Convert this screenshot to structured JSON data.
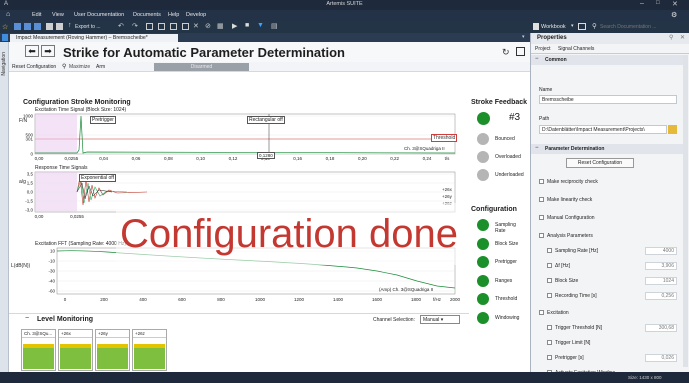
{
  "window": {
    "title": "Artemis SUITE",
    "size_status": "Size: 1430 x 800"
  },
  "menu": {
    "items": [
      "Edit",
      "View",
      "User Documentation",
      "Documents",
      "Help",
      "Develop"
    ]
  },
  "toolbar": {
    "export_label": "Export to ...",
    "workbook_label": "Workbook",
    "search_placeholder": "Search Documentation ..."
  },
  "doc_tab": {
    "label": "Impact Measurement (Roving Hammer) – Bremsscheibe*"
  },
  "leftstrip": {
    "label": "Navigation"
  },
  "page": {
    "title": "Strike for Automatic Parameter Determination",
    "reset_config": "Reset Configuration",
    "maximize": "Maximize",
    "arm": "Arm",
    "disarmed": "Disarmed"
  },
  "monitoring": {
    "title": "Configuration Stroke Monitoring",
    "chart1": {
      "title": "Excitation Time Signal (Block Size: 1024)",
      "ylabel": "F/N",
      "pretrigger": "Pretrigger",
      "rect": "Rectangular off",
      "threshold": "Threshold",
      "legend": "Ch. 3@SQuadriga II",
      "cursor": "0,1280"
    },
    "chart2": {
      "title": "Response Time Signals",
      "ylabel": "a/g",
      "exp": "Exponential off",
      "legend": [
        "+26x",
        "+26y",
        "+26z"
      ]
    },
    "chart3": {
      "title": "Excitation FFT (Sampling Rate: 4000 Hz)",
      "ylabel": "L(dB(N))",
      "legend": "(Amp) Ch. 3@SQuadriga II",
      "xunit": "f/Hz"
    }
  },
  "chart_data": [
    {
      "type": "line",
      "title": "Excitation Time Signal (Block Size: 1024)",
      "ylabel": "F/N",
      "xlabel": "t/s",
      "x_ticks": [
        "0,00",
        "0,0255",
        "0,04",
        "0,06",
        "0,08",
        "0,10",
        "0,12",
        "0,14",
        "0,16",
        "0,18",
        "0,20",
        "0,22",
        "0,24"
      ],
      "y_ticks": [
        "0",
        "301",
        "500",
        "1000"
      ],
      "xlim": [
        0,
        0.25
      ],
      "ylim": [
        0,
        1000
      ]
    },
    {
      "type": "line",
      "title": "Response Time Signals",
      "ylabel": "a/g",
      "x_ticks": [
        "0,00",
        "0,0255"
      ],
      "y_ticks": [
        "3,5",
        "1,5",
        "0,0",
        "-1,5",
        "-3,0"
      ],
      "ylim": [
        -3,
        3.5
      ]
    },
    {
      "type": "line",
      "title": "Excitation FFT (Sampling Rate: 4000 Hz)",
      "ylabel": "L(dB(N))",
      "xlabel": "f/Hz",
      "x_ticks": [
        "0",
        "200",
        "400",
        "600",
        "800",
        "1000",
        "1200",
        "1400",
        "1600",
        "1800",
        "2000"
      ],
      "y_ticks": [
        "10",
        "-10",
        "-30",
        "-40",
        "-60"
      ],
      "xlim": [
        0,
        2000
      ],
      "ylim": [
        -60,
        10
      ]
    }
  ],
  "overlay_text": "Configuration done",
  "feedback": {
    "title": "Stroke Feedback",
    "count": "#3",
    "items": [
      {
        "label": "Bounced",
        "state": "grey"
      },
      {
        "label": "Overloaded",
        "state": "grey"
      },
      {
        "label": "Underloaded",
        "state": "grey"
      }
    ]
  },
  "configuration": {
    "title": "Configuration",
    "items": [
      "Sampling Rate",
      "Block Size",
      "Pretrigger",
      "Ranges",
      "Threshold",
      "Windowing"
    ]
  },
  "level": {
    "title": "Level Monitoring",
    "channel_label": "Channel Selection:",
    "channel_value": "Manual",
    "meters": [
      "Ch. 3@SQu...",
      "+26x",
      "+26y",
      "+26z"
    ]
  },
  "properties": {
    "title": "Properties",
    "tabs": [
      "Project",
      "Signal Channels"
    ],
    "common": "Common",
    "name_label": "Name",
    "name_value": "Bremsscheibe",
    "path_label": "Path",
    "path_value": "D:\\Datenblätter\\Impact Measurement\\Projects\\",
    "param_section": "Parameter Determination",
    "reset_btn": "Reset Configuration",
    "checks": [
      "Make reciprocity check",
      "Make linearity check",
      "Manual Configuration"
    ],
    "analysis": "Analysis Parameters",
    "analysis_rows": [
      {
        "label": "Sampling Rate [Hz]",
        "value": "4000"
      },
      {
        "label": "Δf [Hz]",
        "value": "3,906"
      },
      {
        "label": "Block Size",
        "value": "1024"
      },
      {
        "label": "Recording Time [s]",
        "value": "0,256"
      }
    ],
    "excitation": "Excitation",
    "excitation_rows": [
      {
        "label": "Trigger Threshold [N]",
        "value": "300,68"
      },
      {
        "label": "Trigger Limit [N]",
        "value": ""
      },
      {
        "label": "Pretrigger [s]",
        "value": "0,026"
      },
      {
        "label": "Activate Excitation Window",
        "value": ""
      }
    ]
  }
}
